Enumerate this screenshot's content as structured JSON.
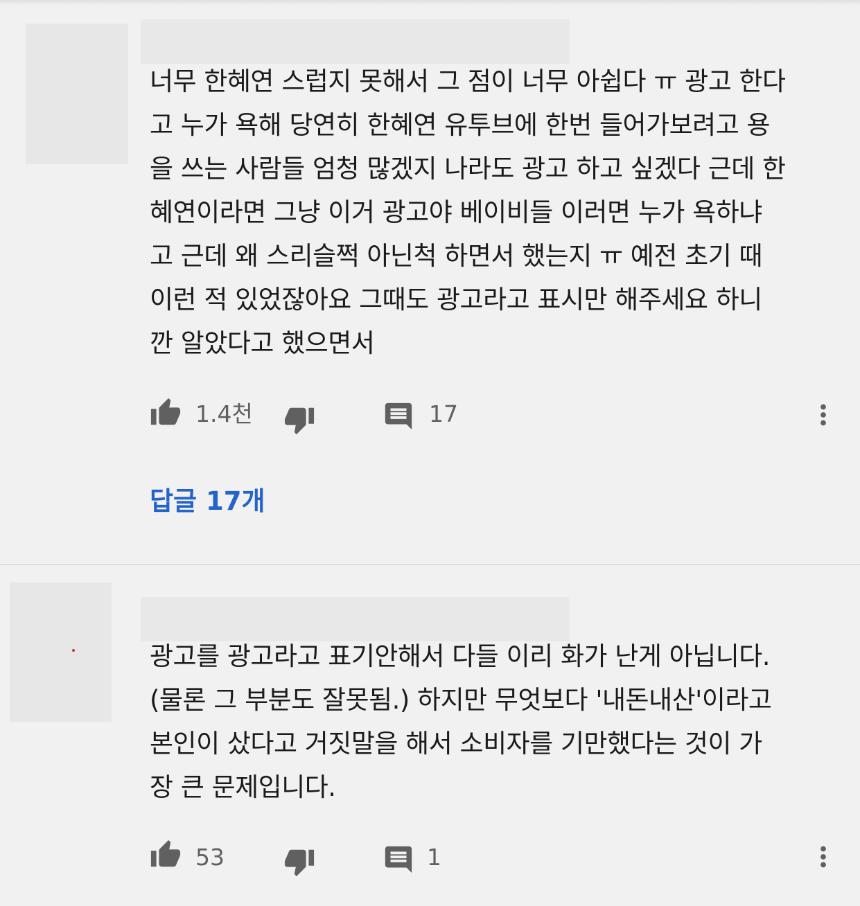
{
  "comments": [
    {
      "text": "너무 한혜연 스럽지 못해서 그 점이 너무 아쉽다 ㅠ 광고 한다\n고 누가 욕해 당연히 한혜연 유투브에 한번 들어가보려고 용\n을 쓰는 사람들 엄청 많겠지 나라도 광고 하고 싶겠다 근데 한\n혜연이라면 그냥 이거 광고야 베이비들 이러면 누가 욕하냐\n고 근데 왜 스리슬쩍 아닌척 하면서 했는지 ㅠ 예전 초기 때\n이런 적 있었잖아요 그때도 광고라고 표시만 해주세요 하니\n깐 알았다고 했으면서",
      "likes": "1.4천",
      "reply_count": "17",
      "replies_link": "답글 17개"
    },
    {
      "text": "광고를 광고라고 표기안해서 다들 이리 화가 난게 아닙니다.\n(물론 그 부분도 잘못됨.) 하지만 무엇보다 '내돈내산'이라고\n본인이 샀다고 거짓말을 해서 소비자를 기만했다는 것이 가\n장 큰 문제입니다.",
      "likes": "53",
      "reply_count": "1"
    }
  ],
  "icons": {
    "like": "thumbs-up-icon",
    "dislike": "thumbs-down-icon",
    "reply": "comment-icon",
    "more": "more-vert-icon"
  },
  "colors": {
    "background": "#f1f1f1",
    "link": "#2463c9",
    "icon": "#606060"
  }
}
